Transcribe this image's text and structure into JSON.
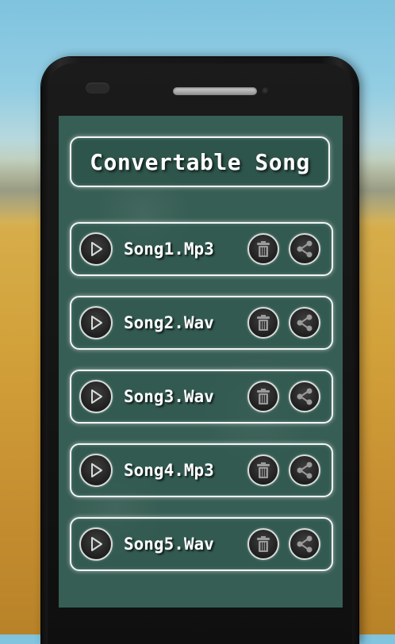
{
  "app": {
    "title": "Convertable Song"
  },
  "songs": [
    {
      "name": "Song1.Mp3"
    },
    {
      "name": "Song2.Wav"
    },
    {
      "name": "Song3.Wav"
    },
    {
      "name": "Song4.Mp3"
    },
    {
      "name": "Song5.Wav"
    }
  ],
  "icons": {
    "play": "play-icon",
    "delete": "trash-icon",
    "share": "share-icon"
  },
  "colors": {
    "screen_background": "#375e54",
    "border_glow": "#f2f6f4",
    "text": "#ffffff",
    "button_fill": "#1f1f1f"
  }
}
